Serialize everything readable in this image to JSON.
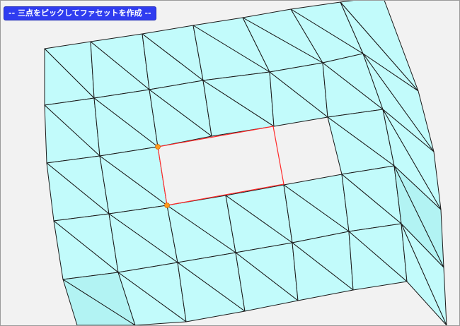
{
  "viewport": {
    "prompt_text": "-- 三点をピックしてファセットを作成 --",
    "background_color": "#f2f2f2",
    "mesh_fill": "#c2fbfb",
    "mesh_fill_shaded": "#b2f3f3",
    "edge_color": "#1a1a1a",
    "hole_edge_color": "#ff2a2a",
    "picked_vertex_color": "#ff9a1a",
    "picked_vertices_count": 2
  }
}
